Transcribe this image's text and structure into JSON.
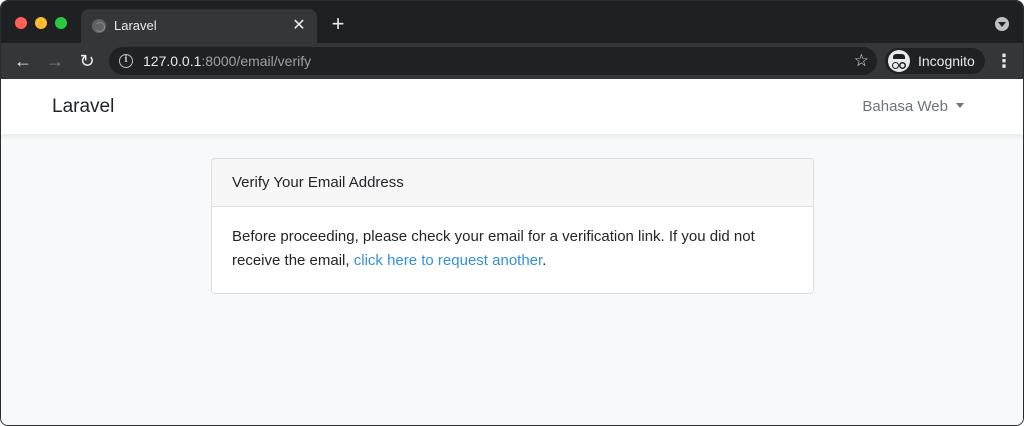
{
  "browser": {
    "tab": {
      "title": "Laravel",
      "close": "✕"
    },
    "new_tab": "+",
    "nav": {
      "back": "←",
      "forward": "→",
      "reload": "↻"
    },
    "omnibox": {
      "url_host": "127.0.0.1",
      "url_rest": ":8000/email/verify",
      "info": "i",
      "star": "☆"
    },
    "profile": {
      "label": "Incognito"
    },
    "menu": "⋮"
  },
  "navbar": {
    "brand": "Laravel",
    "language_dropdown": "Bahasa Web"
  },
  "card": {
    "header": "Verify Your Email Address",
    "body_text": "Before proceeding, please check your email for a verification link. If you did not receive the email, ",
    "link_text": "click here to request another",
    "body_suffix": "."
  }
}
